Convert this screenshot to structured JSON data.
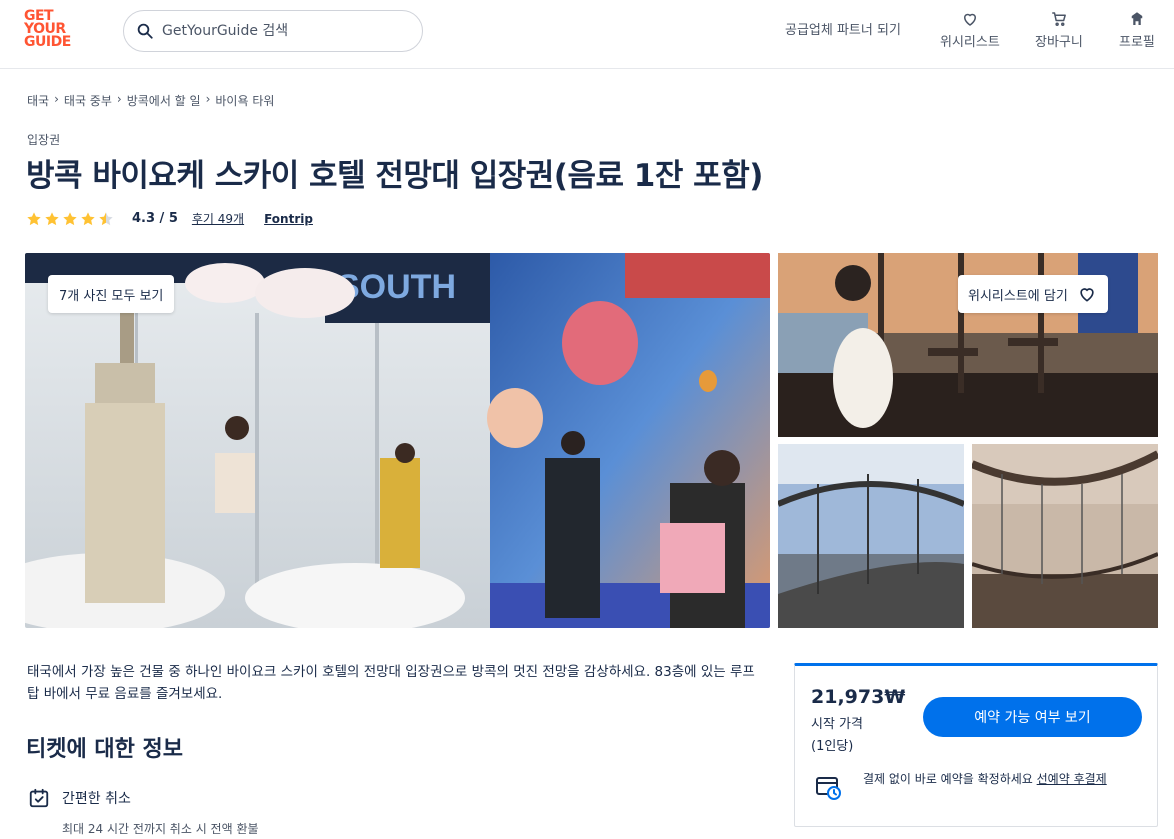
{
  "header": {
    "logo_lines": [
      "GET",
      "YOUR",
      "GUIDE"
    ],
    "search_placeholder": "GetYourGuide 검색",
    "partner": "공급업체 파트너 되기",
    "wishlist": "위시리스트",
    "cart": "장바구니",
    "profile": "프로필"
  },
  "breadcrumb": [
    "태국",
    "태국 중부",
    "방콕에서 할 일",
    "바이욕 타워"
  ],
  "category": "입장권",
  "title": "방콕 바이요케 스카이 호텔 전망대 입장권(음료 1잔 포함)",
  "rating": {
    "stars": 4.3,
    "value_text": "4.3 / 5",
    "reviews_text": "후기 49개",
    "supplier": "Fontrip"
  },
  "gallery": {
    "photos_button": "7개 사진 모두 보기",
    "wishlist_button": "위시리스트에 담기"
  },
  "description": "태국에서 가장 높은 건물 중 하나인 바이요크 스카이 호텔의 전망대 입장권으로 방콕의 멋진 전망을 감상하세요. 83층에 있는 루프탑 바에서 무료 음료를 즐겨보세요.",
  "ticket_section": {
    "title": "티켓에 대한 정보",
    "feature_title": "간편한 취소",
    "feature_sub": "최대 24 시간 전까지 취소 시 전액 환불"
  },
  "booking": {
    "price": "21,973₩",
    "price_label": "시작 가격",
    "price_unit": "(1인당)",
    "button": "예약 가능 여부 보기",
    "note_text": "결제 없이 바로 예약을 확정하세요 ",
    "note_link": "선예약 후결제"
  },
  "colors": {
    "brand": "#ff5533",
    "primary": "#0071eb",
    "text": "#1a2b49",
    "star": "#ffc233"
  }
}
